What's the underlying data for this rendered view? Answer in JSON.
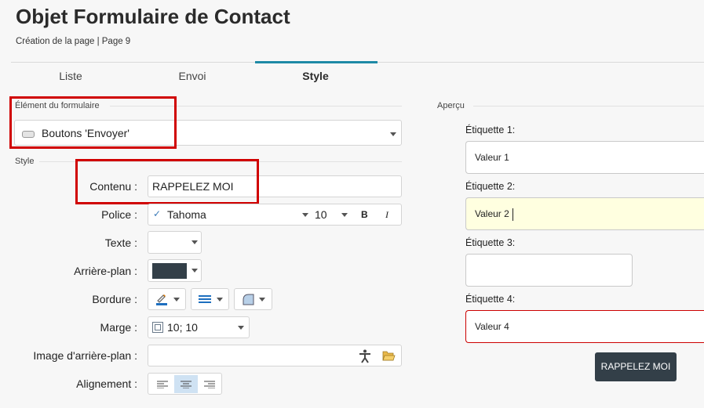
{
  "header": {
    "title": "Objet Formulaire de Contact",
    "subtitle": "Création de la page | Page 9"
  },
  "tabs": [
    {
      "label": "Liste",
      "active": false
    },
    {
      "label": "Envoi",
      "active": false
    },
    {
      "label": "Style",
      "active": true
    }
  ],
  "element_section": {
    "label": "Élément du formulaire",
    "selected": "Boutons 'Envoyer'"
  },
  "style_section": {
    "label": "Style",
    "contenu": {
      "label": "Contenu :",
      "value": "RAPPELEZ MOI"
    },
    "police": {
      "label": "Police :",
      "font": "Tahoma",
      "size": "10",
      "bold": "B",
      "italic": "I"
    },
    "texte": {
      "label": "Texte :",
      "color": "#ffffff"
    },
    "arriere_plan": {
      "label": "Arrière-plan :",
      "color": "#333f48"
    },
    "bordure": {
      "label": "Bordure :"
    },
    "marge": {
      "label": "Marge :",
      "value": "10; 10"
    },
    "image": {
      "label": "Image d'arrière-plan :"
    },
    "alignement": {
      "label": "Alignement :",
      "selected": "center"
    }
  },
  "preview": {
    "label": "Aperçu",
    "fields": [
      {
        "label": "Étiquette 1:",
        "value": "Valeur 1",
        "state": "normal"
      },
      {
        "label": "Étiquette 2:",
        "value": "Valeur 2",
        "state": "focused"
      },
      {
        "label": "Étiquette 3:",
        "value": "",
        "state": "normal"
      },
      {
        "label": "Étiquette 4:",
        "value": "Valeur 4",
        "state": "error"
      }
    ],
    "submit_label": "RAPPELEZ MOI"
  },
  "colors": {
    "accent": "#1e8aa6",
    "highlight_box": "#d00000",
    "focused_bg": "#ffffe0",
    "error_border": "#cc0000"
  }
}
